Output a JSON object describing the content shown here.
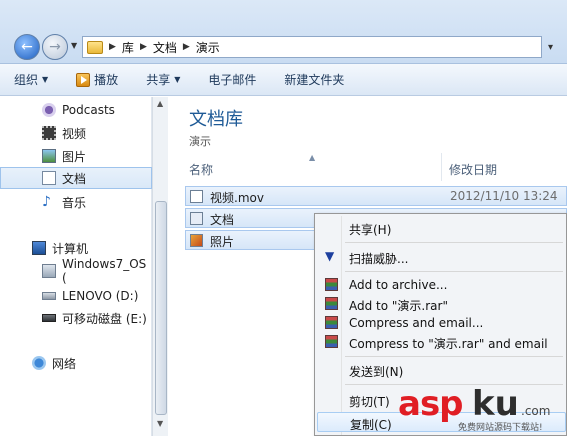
{
  "address": {
    "crumbs": [
      "库",
      "文档",
      "演示"
    ]
  },
  "toolbar": {
    "organize": "组织",
    "play": "播放",
    "share": "共享",
    "email": "电子邮件",
    "new_folder": "新建文件夹"
  },
  "nav": {
    "podcasts": "Podcasts",
    "videos": "视频",
    "pictures": "图片",
    "documents": "文档",
    "music": "音乐",
    "computer": "计算机",
    "drive_c": "Windows7_OS (",
    "drive_d": "LENOVO (D:)",
    "drive_e": "可移动磁盘 (E:)",
    "network": "网络"
  },
  "content": {
    "library_title": "文档库",
    "library_sub": "演示",
    "col_name": "名称",
    "col_date": "修改日期",
    "files": [
      {
        "name": "视频.mov",
        "date": "2012/11/10 13:24"
      },
      {
        "name": "文档",
        "date": ""
      },
      {
        "name": "照片",
        "date": ""
      }
    ]
  },
  "context_menu": {
    "share": "共享(H)",
    "scan": "扫描威胁...",
    "add_archive": "Add to archive...",
    "add_rar": "Add to \"演示.rar\"",
    "compress_email": "Compress and email...",
    "compress_rar_email": "Compress to \"演示.rar\" and email",
    "send_to": "发送到(N)",
    "cut": "剪切(T)",
    "copy": "复制(C)"
  },
  "watermark": {
    "brand_a": "asp",
    "brand_b": "ku",
    "brand_c": ".com",
    "tagline": "免费网站源码下载站!"
  }
}
